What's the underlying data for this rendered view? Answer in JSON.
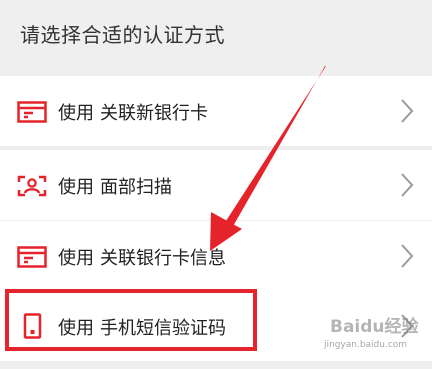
{
  "header": {
    "title": "请选择合适的认证方式"
  },
  "options": [
    {
      "icon": "bank-card-icon",
      "use_label": "使用",
      "method": "关联新银行卡"
    },
    {
      "icon": "face-scan-icon",
      "use_label": "使用",
      "method": "面部扫描"
    },
    {
      "icon": "bank-card-icon",
      "use_label": "使用",
      "method": "关联银行卡信息"
    },
    {
      "icon": "phone-icon",
      "use_label": "使用",
      "method": "手机短信验证码"
    }
  ],
  "annotation": {
    "highlighted_option": "手机短信验证码",
    "color": "#e5232a"
  },
  "watermark": {
    "name": "Baidu经验",
    "url": "jingyan.baidu.com"
  },
  "colors": {
    "icon_red": "#e5232a",
    "text": "#222222",
    "chevron": "#9a9a9a",
    "background": "#eeeeee"
  }
}
